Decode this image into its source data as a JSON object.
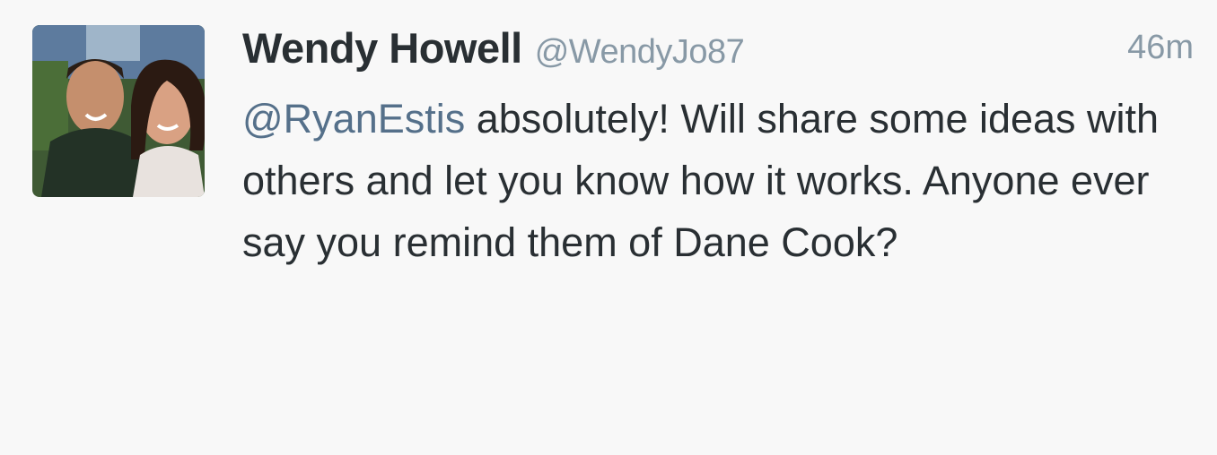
{
  "tweet": {
    "avatar_icon": "user-avatar-photo",
    "name": "Wendy Howell",
    "screen_name": "@WendyJo87",
    "timestamp": "46m",
    "mention": "@RyanEstis",
    "text": " absolutely! Will share some ideas with others and let you know how it works. Anyone ever say you remind them of Dane Cook?"
  },
  "colors": {
    "background": "#f8f8f8",
    "name": "#292f33",
    "meta": "#8899a6",
    "mention": "#55708a"
  }
}
